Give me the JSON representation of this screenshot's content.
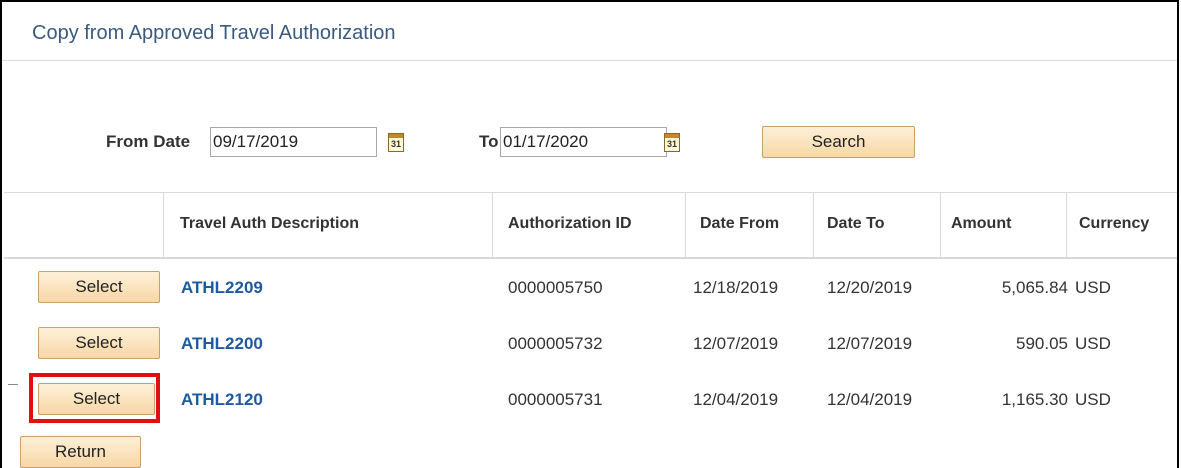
{
  "title": "Copy from Approved Travel Authorization",
  "search": {
    "from_label": "From Date",
    "from_value": "09/17/2019",
    "to_label": "To",
    "to_value": "01/17/2020",
    "calendar_icon_text": "31",
    "search_label": "Search"
  },
  "grid": {
    "headers": [
      "Travel Auth Description",
      "Authorization ID",
      "Date From",
      "Date To",
      "Amount",
      "Currency"
    ],
    "rows": [
      {
        "select": "Select",
        "description": "ATHL2209",
        "auth_id": "0000005750",
        "date_from": "12/18/2019",
        "date_to": "12/20/2019",
        "amount": "5,065.84",
        "currency": "USD"
      },
      {
        "select": "Select",
        "description": "ATHL2200",
        "auth_id": "0000005732",
        "date_from": "12/07/2019",
        "date_to": "12/07/2019",
        "amount": "590.05",
        "currency": "USD"
      },
      {
        "select": "Select",
        "description": "ATHL2120",
        "auth_id": "0000005731",
        "date_from": "12/04/2019",
        "date_to": "12/04/2019",
        "amount": "1,165.30",
        "currency": "USD"
      }
    ],
    "highlighted_row": 2,
    "highlight_color": "#e01010"
  },
  "return_label": "Return",
  "colors": {
    "title": "#3a5a80",
    "link": "#1d5aa3",
    "button_top": "#fdf0d8",
    "button_bottom": "#f7d7a6"
  }
}
